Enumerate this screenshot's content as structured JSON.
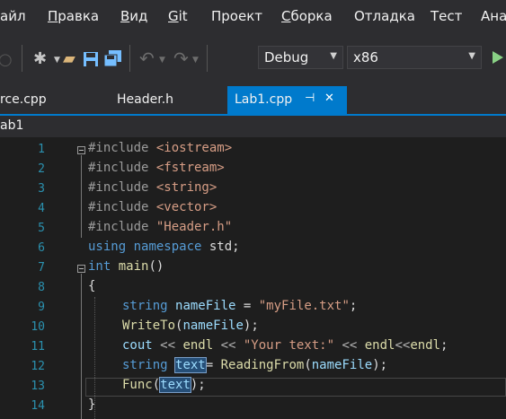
{
  "menu": [
    "айл",
    "Правка",
    "Вид",
    "Git",
    "Проект",
    "Сборка",
    "Отладка",
    "Тест",
    "Ана"
  ],
  "toolbar": {
    "config": "Debug",
    "platform": "x86",
    "icons": [
      "circle-icon",
      "new-project-icon",
      "open-folder-icon",
      "save-icon",
      "save-all-icon",
      "undo-icon",
      "redo-icon",
      "start-debug-icon"
    ]
  },
  "tabs": [
    {
      "label": "rce.cpp",
      "active": false
    },
    {
      "label": "Header.h",
      "active": false
    },
    {
      "label": "Lab1.cpp",
      "active": true
    }
  ],
  "tab_pin_glyph": "⊣",
  "tab_close_glyph": "✕",
  "navbar": {
    "label": "ab1"
  },
  "line_numbers": [
    "1",
    "2",
    "3",
    "4",
    "5",
    "6",
    "7",
    "8",
    "9",
    "10",
    "11",
    "12",
    "13",
    "14"
  ],
  "colors": {
    "accent": "#007acc",
    "editor_bg": "#1e1e1e",
    "chrome_bg": "#2d2d30",
    "line_number": "#2b91af"
  },
  "code": {
    "l1": {
      "a": "#include ",
      "b": "<iostream>"
    },
    "l2": {
      "a": "#include ",
      "b": "<fstream>"
    },
    "l3": {
      "a": "#include ",
      "b": "<string>"
    },
    "l4": {
      "a": "#include ",
      "b": "<vector>"
    },
    "l5": {
      "a": "#include ",
      "b": "\"Header.h\""
    },
    "l6": {
      "a": "using",
      "b": " ",
      "c": "namespace",
      "d": " std;"
    },
    "l7": {
      "a": "int",
      "b": " ",
      "c": "main",
      "d": "()"
    },
    "l8": {
      "a": "{"
    },
    "l9": {
      "a": "string",
      "b": " ",
      "c": "nameFile",
      "d": " = ",
      "e": "\"myFile.txt\"",
      "f": ";"
    },
    "l10": {
      "a": "WriteTo",
      "b": "(",
      "c": "nameFile",
      "d": ");"
    },
    "l11": {
      "a": "cout",
      "b": " << ",
      "c": "endl",
      "d": " << ",
      "e": "\"Your text:\"",
      "f": " << ",
      "g": "endl",
      "h": "<<",
      "i": "endl",
      "j": ";"
    },
    "l12": {
      "a": "string",
      "b": " ",
      "c": "text",
      "d": "= ",
      "e": "ReadingFrom",
      "f": "(",
      "g": "nameFile",
      "h": ");"
    },
    "l13": {
      "a": "Func",
      "b": "(",
      "c": "text",
      "d": ");"
    },
    "l14": {
      "a": "}"
    }
  }
}
